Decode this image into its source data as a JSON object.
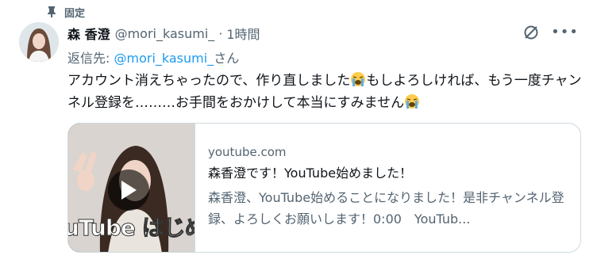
{
  "pinned": {
    "label": "固定",
    "icon": "pin-icon"
  },
  "author": {
    "name": "森 香澄",
    "handle": "@mori_kasumi_",
    "separator": "·",
    "time": "1時間",
    "avatar_icon": "avatar"
  },
  "actions": {
    "hide_icon": "hide-icon",
    "more_label": "•••"
  },
  "reply": {
    "prefix": "返信先: ",
    "link": "@mori_kasumi_",
    "suffix": "さん"
  },
  "tweet": {
    "line1": "アカウント消えちゃったので、作り直しました",
    "line1_after": "もしよろしければ、もう一度チャンネル登録を………お手間をおかけして本当にすみません",
    "emoji": "loudly-crying-face-icon"
  },
  "card": {
    "domain": "youtube.com",
    "title": "森香澄です！YouTube始めました！",
    "description": "森香澄、YouTube始めることになりました！是非チャンネル登録、よろしくお願いします！0:00　YouTub...",
    "thumbnail_overlay": "uTube はじめ",
    "play_icon": "play-icon"
  },
  "colors": {
    "accent": "#1d9bf0",
    "secondary_text": "#536471",
    "border": "#cfd9de"
  }
}
